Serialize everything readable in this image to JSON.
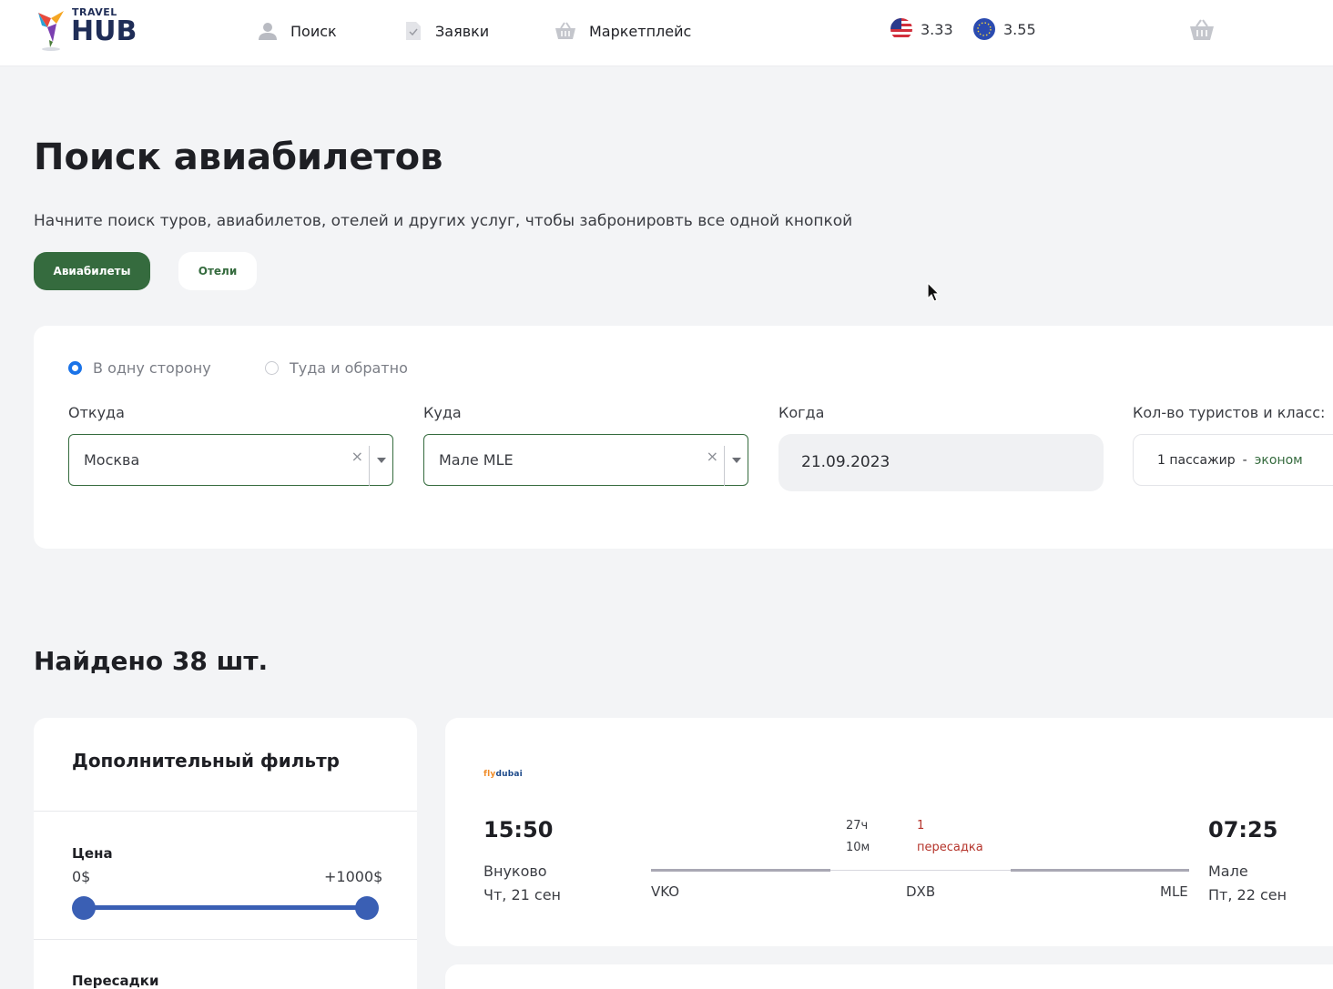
{
  "header": {
    "logo_small": "TRAVEL",
    "logo_big": "HUB",
    "nav": [
      {
        "label": "Поиск",
        "icon": "user-icon"
      },
      {
        "label": "Заявки",
        "icon": "document-icon"
      },
      {
        "label": "Маркетплейс",
        "icon": "basket-icon"
      }
    ],
    "rates": [
      {
        "value": "3.33",
        "icon": "us-flag-icon"
      },
      {
        "value": "3.55",
        "icon": "eu-flag-icon"
      }
    ]
  },
  "page": {
    "title": "Поиск авиабилетов",
    "subtitle": "Начните поиск туров, авиабилетов, отелей и других услуг, чтобы забронировть все одной кнопкой",
    "tabs": [
      "Авиабилеты",
      "Отели"
    ]
  },
  "search": {
    "trip_types": [
      "В одну сторону",
      "Туда и обратно"
    ],
    "selected_trip": "В одну сторону",
    "from_label": "Откуда",
    "from_value": "Москва",
    "to_label": "Куда",
    "to_value": "Мале MLE",
    "when_label": "Когда",
    "when_value": "21.09.2023",
    "pax_label": "Кол-во туристов и класс:",
    "pax_value": "1 пассажир",
    "pax_sep": "-",
    "pax_class": "эконом",
    "clear_glyph": "×"
  },
  "results": {
    "found": "Найдено 38 шт."
  },
  "filter": {
    "title": "Дополнительный фильтр",
    "price_label": "Цена",
    "price_min": "0$",
    "price_max": "+1000$",
    "price_range_fraction": [
      0,
      1
    ],
    "stops_label": "Пересадки"
  },
  "flight": {
    "airline_a": "fly",
    "airline_b": "dubai",
    "dep_time": "15:50",
    "dep_city": "Внуково",
    "dep_day": "Чт, 21 сен",
    "duration_h": "27ч",
    "duration_m": "10м",
    "stops_count": "1",
    "stops_label": "пересадка",
    "codes": [
      "VKO",
      "DXB",
      "MLE"
    ],
    "arr_time": "07:25",
    "arr_city": "Мале",
    "arr_day": "Пт, 22 сен"
  },
  "colors": {
    "accent_green": "#356b3e",
    "accent_blue": "#3a5fb4",
    "stop_red": "#b5342b"
  }
}
